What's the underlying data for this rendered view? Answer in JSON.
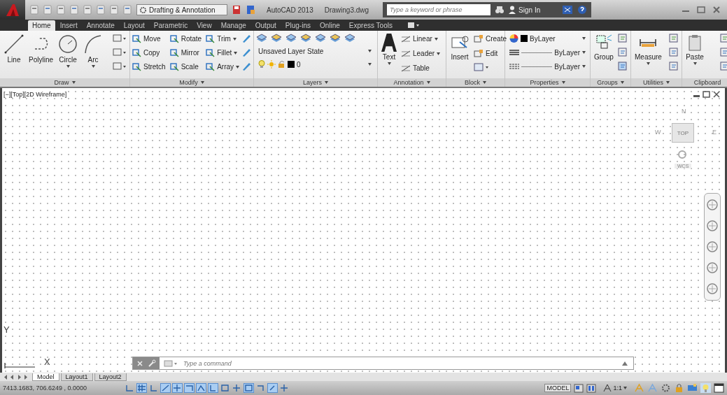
{
  "title_bar": {
    "workspace": "Drafting & Annotation",
    "app_name": "AutoCAD 2013",
    "file_name": "Drawing3.dwg",
    "search": {
      "placeholder": "Type a keyword or phrase"
    },
    "sign_in": "Sign In"
  },
  "tabs": [
    {
      "label": "Home",
      "selected": true
    },
    {
      "label": "Insert",
      "selected": false
    },
    {
      "label": "Annotate",
      "selected": false
    },
    {
      "label": "Layout",
      "selected": false
    },
    {
      "label": "Parametric",
      "selected": false
    },
    {
      "label": "View",
      "selected": false
    },
    {
      "label": "Manage",
      "selected": false
    },
    {
      "label": "Output",
      "selected": false
    },
    {
      "label": "Plug-ins",
      "selected": false
    },
    {
      "label": "Online",
      "selected": false
    },
    {
      "label": "Express Tools",
      "selected": false
    }
  ],
  "panels": [
    {
      "kind": "draw",
      "title": "Draw",
      "items": [
        {
          "label": "Line",
          "dropdown": false
        },
        {
          "label": "Polyline",
          "dropdown": false
        },
        {
          "label": "Circle",
          "dropdown": true
        },
        {
          "label": "Arc",
          "dropdown": true
        }
      ]
    },
    {
      "kind": "modify",
      "title": "Modify",
      "items": [
        {
          "label": "Move",
          "dropdown": false
        },
        {
          "label": "Rotate",
          "dropdown": false
        },
        {
          "label": "Trim",
          "dropdown": true
        },
        {
          "label": "Copy",
          "dropdown": false
        },
        {
          "label": "Mirror",
          "dropdown": false
        },
        {
          "label": "Fillet",
          "dropdown": true
        },
        {
          "label": "Stretch",
          "dropdown": false
        },
        {
          "label": "Scale",
          "dropdown": false
        },
        {
          "label": "Array",
          "dropdown": true
        }
      ]
    },
    {
      "kind": "layers",
      "title": "Layers",
      "layer_state": "Unsaved Layer State",
      "current_layer": "0"
    },
    {
      "kind": "annotation",
      "title": "Annotation",
      "items": [
        {
          "label": "Text",
          "dropdown": true
        },
        {
          "label": "Linear",
          "dropdown": true
        },
        {
          "label": "Leader",
          "dropdown": true
        },
        {
          "label": "Table",
          "dropdown": false
        }
      ]
    },
    {
      "kind": "block",
      "title": "Block",
      "items": [
        {
          "label": "Insert",
          "dropdown": false
        },
        {
          "label": "Create",
          "dropdown": false
        },
        {
          "label": "Edit",
          "dropdown": false
        }
      ]
    },
    {
      "kind": "properties",
      "title": "Properties",
      "items": [
        {
          "label": "ByLayer"
        },
        {
          "label": "ByLayer"
        },
        {
          "label": "ByLayer"
        }
      ]
    },
    {
      "kind": "groups",
      "title": "Groups",
      "items": [
        {
          "label": "Group",
          "dropdown": false
        }
      ]
    },
    {
      "kind": "utilities",
      "title": "Utilities",
      "items": [
        {
          "label": "Measure",
          "dropdown": true
        }
      ]
    },
    {
      "kind": "clipboard",
      "title": "Clipboard",
      "items": [
        {
          "label": "Paste",
          "dropdown": true
        }
      ]
    }
  ],
  "viewport": {
    "label": "[−][Top][2D Wireframe]"
  },
  "viewcube": {
    "north": "N",
    "west": "W",
    "face": "TOP",
    "east": "E",
    "ucs": "WCS"
  },
  "ucs_icon": {
    "y": "Y",
    "x": "X"
  },
  "command_line": {
    "placeholder": "Type a command"
  },
  "layout_tabs": [
    {
      "label": "Model",
      "selected": true
    },
    {
      "label": "Layout1",
      "selected": false
    },
    {
      "label": "Layout2",
      "selected": false
    }
  ],
  "status_bar": {
    "coordinates": "7413.1683, 706.6249 , 0.0000",
    "toggles": [
      {
        "on": false
      },
      {
        "on": true
      },
      {
        "on": false
      },
      {
        "on": true
      },
      {
        "on": true
      },
      {
        "on": true
      },
      {
        "on": true
      },
      {
        "on": true
      },
      {
        "on": false
      },
      {
        "on": false
      },
      {
        "on": true
      },
      {
        "on": false
      },
      {
        "on": true
      },
      {
        "on": false
      }
    ],
    "model": "MODEL",
    "scale": "1:1"
  }
}
